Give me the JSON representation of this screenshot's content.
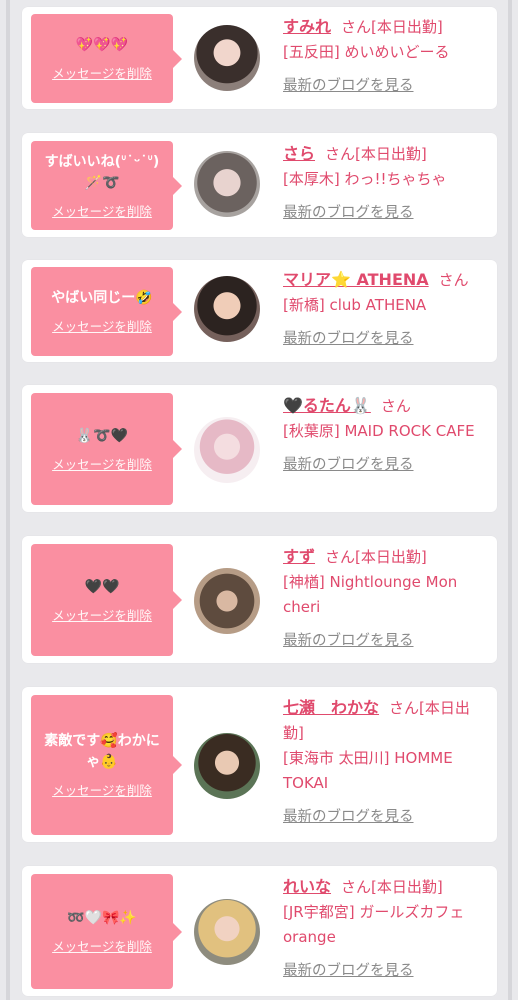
{
  "delete_label": "メッセージを削除",
  "blog_label": "最新のブログを見る",
  "san": "さん",
  "colors": {
    "accent": "#e04a6d",
    "bubble": "#fa8fa1",
    "link_gray": "#8a8a8a"
  },
  "cards": [
    {
      "message": "💖💖💖",
      "name": "すみれ",
      "status": "[本日出勤]",
      "shop": "[五反田] めいめいどーる"
    },
    {
      "message": "すばいいね(ᐡ˙ᵕ˙ᐡ)🪄➰",
      "name": "さら",
      "status": "[本日出勤]",
      "shop": "[本厚木] わっ!!ちゃちゃ"
    },
    {
      "message": "やばい同じー🤣",
      "name": "マリア⭐ ATHENA",
      "status": "",
      "shop": "[新橋] club ATHENA"
    },
    {
      "message": "🐰➰🖤",
      "name": "🖤るたん🐰",
      "status": "",
      "shop": "[秋葉原] MAID ROCK CAFE"
    },
    {
      "message": "🖤🖤",
      "name": "すず",
      "status": "[本日出勤]",
      "shop": "[神楢] Nightlounge Mon cheri"
    },
    {
      "message": "素敵です🥰わかにゃ👶",
      "name": "七瀬　わかな",
      "status": "[本日出勤]",
      "shop": "[東海市 太田川] HOMME TOKAI"
    },
    {
      "message": "➿🤍🎀✨",
      "name": "れいな",
      "status": "[本日出勤]",
      "shop": "[JR宇都宮] ガールズカフェ orange"
    }
  ]
}
